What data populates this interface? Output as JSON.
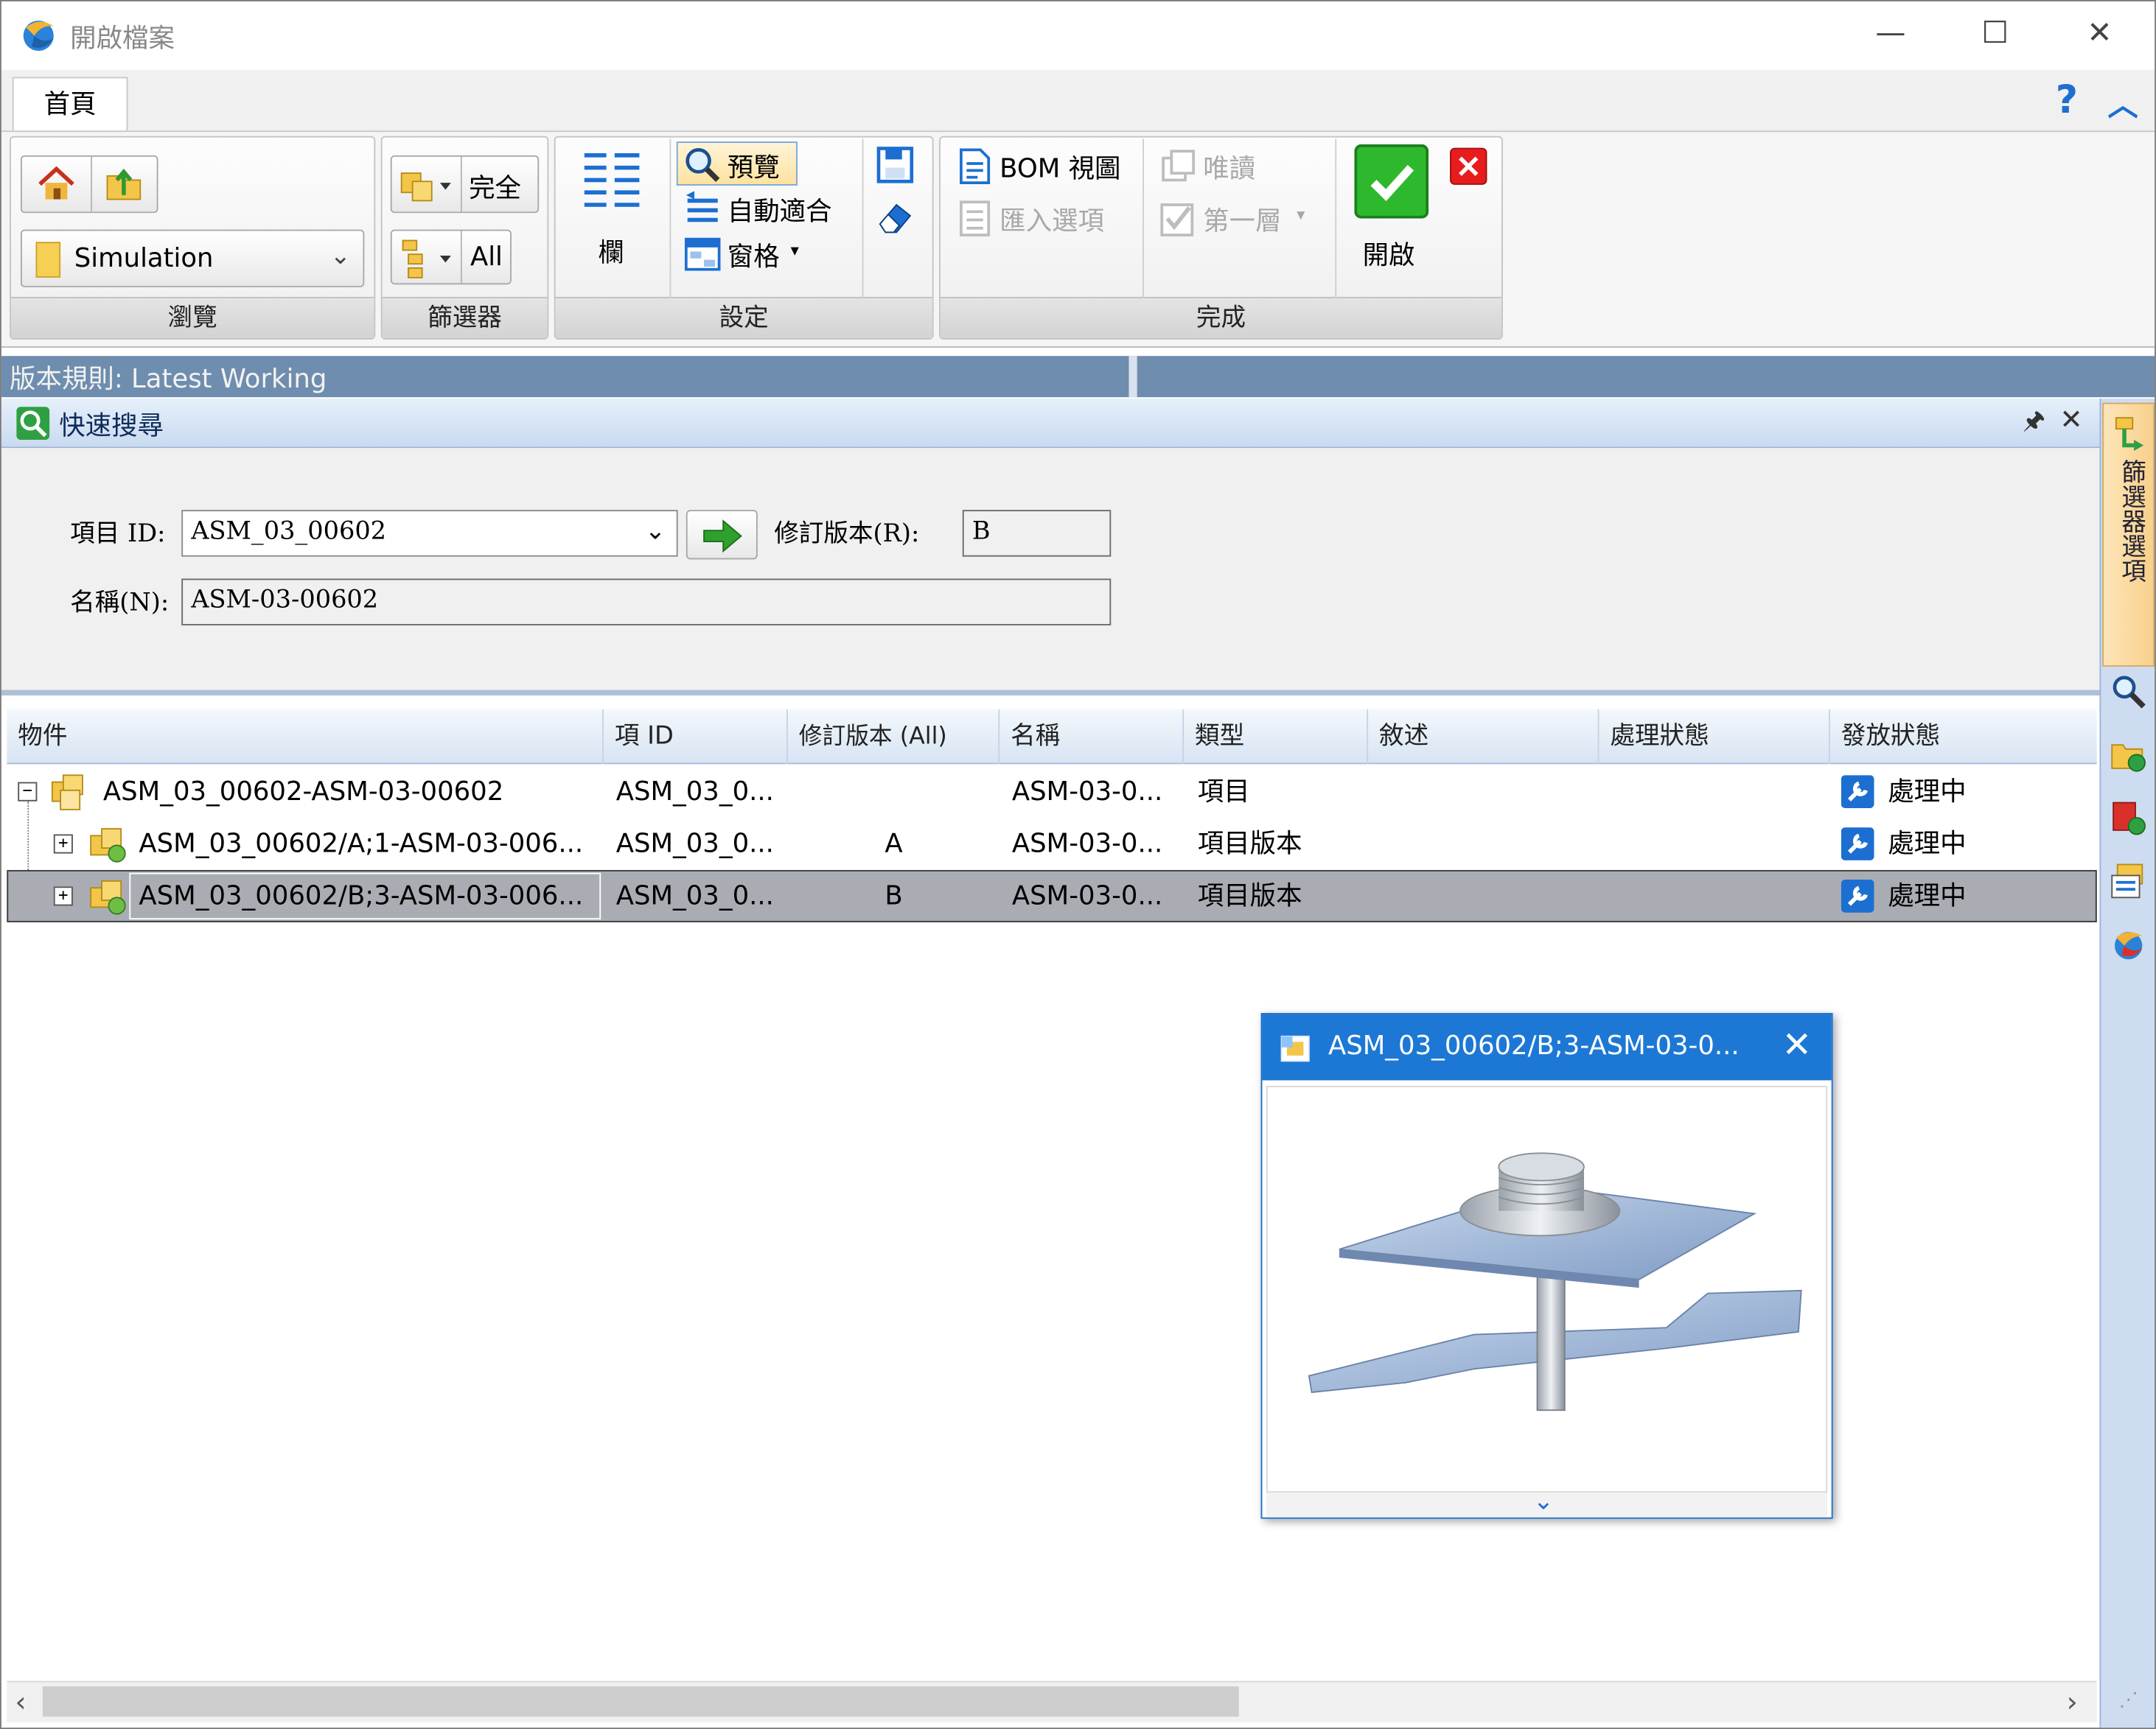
{
  "window": {
    "title": "開啟檔案"
  },
  "tabs": {
    "home": "首頁"
  },
  "ribbon": {
    "browse": {
      "dropdown_value": "Simulation",
      "group_label": "瀏覽"
    },
    "filter": {
      "complete_label": "完全",
      "all_label": "All",
      "group_label": "篩選器"
    },
    "settings": {
      "columns_label": "欄",
      "preview_label": "預覽",
      "autofit_label": "自動適合",
      "pane_label": "窗格",
      "group_label": "設定"
    },
    "finish": {
      "bom_view_label": "BOM 視圖",
      "readonly_label": "唯讀",
      "import_options_label": "匯入選項",
      "first_level_label": "第一層",
      "group_label": "完成"
    },
    "open_label": "開啟"
  },
  "version_rule": {
    "text": "版本規則: Latest Working"
  },
  "quick_search": {
    "title": "快速搜尋",
    "item_id_label": "項目 ID:",
    "item_id_value": "ASM_03_00602",
    "revision_label": "修訂版本(R):",
    "revision_value": "B",
    "name_label": "名稱(N):",
    "name_value": "ASM-03-00602"
  },
  "table": {
    "columns": [
      "物件",
      "項 ID",
      "修訂版本 (All)",
      "名稱",
      "類型",
      "敘述",
      "處理狀態",
      "發放狀態"
    ],
    "rows": [
      {
        "object": "ASM_03_00602-ASM-03-00602",
        "item_id": "ASM_03_0...",
        "revision": "",
        "name": "ASM-03-0...",
        "type": "項目",
        "description": "",
        "process_status": "",
        "release_status": "處理中"
      },
      {
        "object": "ASM_03_00602/A;1-ASM-03-006...",
        "item_id": "ASM_03_0...",
        "revision": "A",
        "name": "ASM-03-0...",
        "type": "項目版本",
        "description": "",
        "process_status": "",
        "release_status": "處理中"
      },
      {
        "object": "ASM_03_00602/B;3-ASM-03-006...",
        "item_id": "ASM_03_0...",
        "revision": "B",
        "name": "ASM-03-0...",
        "type": "項目版本",
        "description": "",
        "process_status": "",
        "release_status": "處理中"
      }
    ]
  },
  "preview_popup": {
    "title": "ASM_03_00602/B;3-ASM-03-0..."
  },
  "side_panel": {
    "tab_label": "篩選器選項"
  },
  "colors": {
    "accent": "#1c78d4",
    "version_bar": "#6f8dae",
    "selected_row": "#a9adb3",
    "open_green": "#2eb82e",
    "close_red": "#e81c1c"
  }
}
